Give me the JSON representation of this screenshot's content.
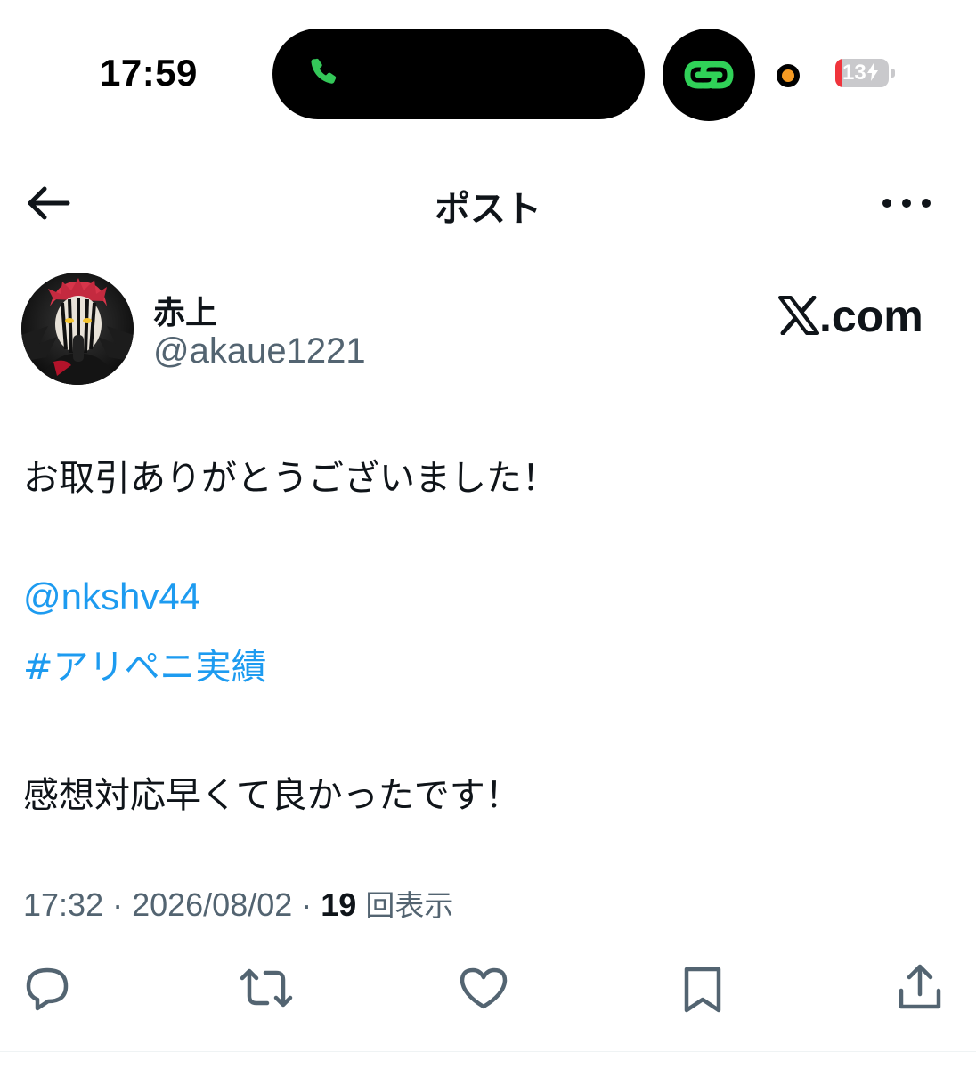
{
  "status_bar": {
    "time": "17:59",
    "battery_level": "13",
    "battery_fraction": 0.13,
    "charging": true,
    "accent_call": "#34c759",
    "accent_link": "#30d158",
    "accent_mic": "#f59a23",
    "accent_battery_low": "#f0343c"
  },
  "header": {
    "title": "ポスト",
    "back_icon": "arrow-left-icon",
    "more_icon": "more-horizontal-icon"
  },
  "author": {
    "display_name": "赤上",
    "handle": "@akaue1221"
  },
  "brand": {
    "logo_icon": "x-logo-icon",
    "domain": ".com"
  },
  "post": {
    "line1": "お取引ありがとうございました！",
    "mention": "@nkshv44",
    "hashtag": "#アリペニ実績",
    "line2": "感想対応早くて良かったです！",
    "link_color": "#1d9bf0"
  },
  "meta": {
    "time": "17:32",
    "separator": " · ",
    "date": "2026/08/02",
    "views_count": "19",
    "views_label": "回表示"
  },
  "actions": [
    {
      "name": "reply",
      "icon": "reply-icon"
    },
    {
      "name": "repost",
      "icon": "repost-icon"
    },
    {
      "name": "like",
      "icon": "heart-icon"
    },
    {
      "name": "bookmark",
      "icon": "bookmark-icon"
    },
    {
      "name": "share",
      "icon": "share-icon"
    }
  ]
}
